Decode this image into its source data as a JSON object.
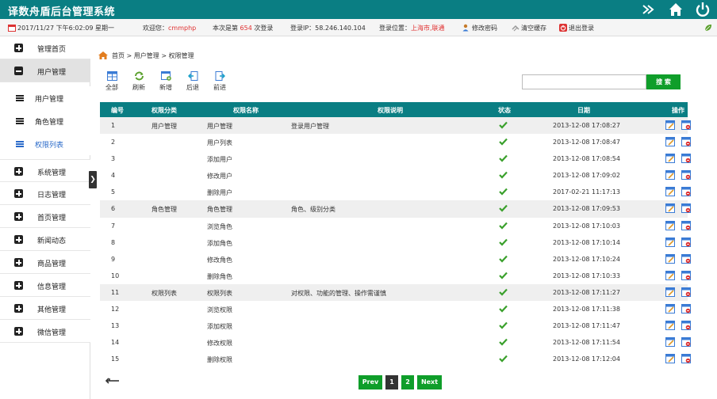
{
  "header": {
    "title": "译数舟盾后台管理系统"
  },
  "infobar": {
    "datetime": "2017/11/27 下午6:02:09 星期一",
    "welcome_prefix": "欢迎您：",
    "username": "cmmphp",
    "login_count_prefix": "本次是第",
    "login_count": "654",
    "login_count_suffix": "次登录",
    "login_ip": "登录IP：58.246.140.104",
    "location_prefix": "登录位置：",
    "location": "上海市,联通",
    "change_password": "修改密码",
    "clear_cache": "清空缓存",
    "logout": "退出登录"
  },
  "sidebar": {
    "items": [
      {
        "label": "管理首页"
      },
      {
        "label": "用户管理"
      },
      {
        "label": "系统管理"
      },
      {
        "label": "日志管理"
      },
      {
        "label": "首页管理"
      },
      {
        "label": "新闻动态"
      },
      {
        "label": "商品管理"
      },
      {
        "label": "信息管理"
      },
      {
        "label": "其他管理"
      },
      {
        "label": "微信管理"
      }
    ],
    "subitems": [
      {
        "label": "用户管理"
      },
      {
        "label": "角色管理"
      },
      {
        "label": "权限列表"
      }
    ]
  },
  "breadcrumb": {
    "home": "首页",
    "sep1": ">",
    "level1": "用户管理",
    "sep2": ">",
    "level2": "权限管理"
  },
  "toolbar": {
    "all": "全部",
    "refresh": "刷新",
    "add": "新增",
    "back": "后退",
    "forward": "前进"
  },
  "search": {
    "value": "",
    "button": "搜 索"
  },
  "table": {
    "headers": {
      "id": "编号",
      "category": "权限分类",
      "name": "权限名称",
      "desc": "权限说明",
      "status": "状态",
      "date": "日期",
      "ops": "操作"
    },
    "rows": [
      {
        "id": "1",
        "category": "用户管理",
        "name": "用户管理",
        "desc": "登录用户管理",
        "date": "2013-12-08 17:08:27",
        "group": true
      },
      {
        "id": "2",
        "category": "",
        "name": "用户列表",
        "desc": "",
        "date": "2013-12-08 17:08:47",
        "group": false
      },
      {
        "id": "3",
        "category": "",
        "name": "添加用户",
        "desc": "",
        "date": "2013-12-08 17:08:54",
        "group": false
      },
      {
        "id": "4",
        "category": "",
        "name": "修改用户",
        "desc": "",
        "date": "2013-12-08 17:09:02",
        "group": false
      },
      {
        "id": "5",
        "category": "",
        "name": "删除用户",
        "desc": "",
        "date": "2017-02-21 11:17:13",
        "group": false
      },
      {
        "id": "6",
        "category": "角色管理",
        "name": "角色管理",
        "desc": "角色、级别分类",
        "date": "2013-12-08 17:09:53",
        "group": true
      },
      {
        "id": "7",
        "category": "",
        "name": "浏览角色",
        "desc": "",
        "date": "2013-12-08 17:10:03",
        "group": false
      },
      {
        "id": "8",
        "category": "",
        "name": "添加角色",
        "desc": "",
        "date": "2013-12-08 17:10:14",
        "group": false
      },
      {
        "id": "9",
        "category": "",
        "name": "修改角色",
        "desc": "",
        "date": "2013-12-08 17:10:24",
        "group": false
      },
      {
        "id": "10",
        "category": "",
        "name": "删除角色",
        "desc": "",
        "date": "2013-12-08 17:10:33",
        "group": false
      },
      {
        "id": "11",
        "category": "权限列表",
        "name": "权限列表",
        "desc": "对权限、功能的管理、操作需谨慎",
        "date": "2013-12-08 17:11:27",
        "group": true
      },
      {
        "id": "12",
        "category": "",
        "name": "浏览权限",
        "desc": "",
        "date": "2013-12-08 17:11:38",
        "group": false
      },
      {
        "id": "13",
        "category": "",
        "name": "添加权限",
        "desc": "",
        "date": "2013-12-08 17:11:47",
        "group": false
      },
      {
        "id": "14",
        "category": "",
        "name": "修改权限",
        "desc": "",
        "date": "2013-12-08 17:11:54",
        "group": false
      },
      {
        "id": "15",
        "category": "",
        "name": "删除权限",
        "desc": "",
        "date": "2013-12-08 17:12:04",
        "group": false
      }
    ]
  },
  "pagination": {
    "prev": "Prev",
    "page1": "1",
    "page2": "2",
    "next": "Next"
  },
  "colors": {
    "brand": "#0a7e83",
    "green_button": "#0f9e2a",
    "highlight_red": "#e03030",
    "selected_blue": "#2a6ac9"
  }
}
